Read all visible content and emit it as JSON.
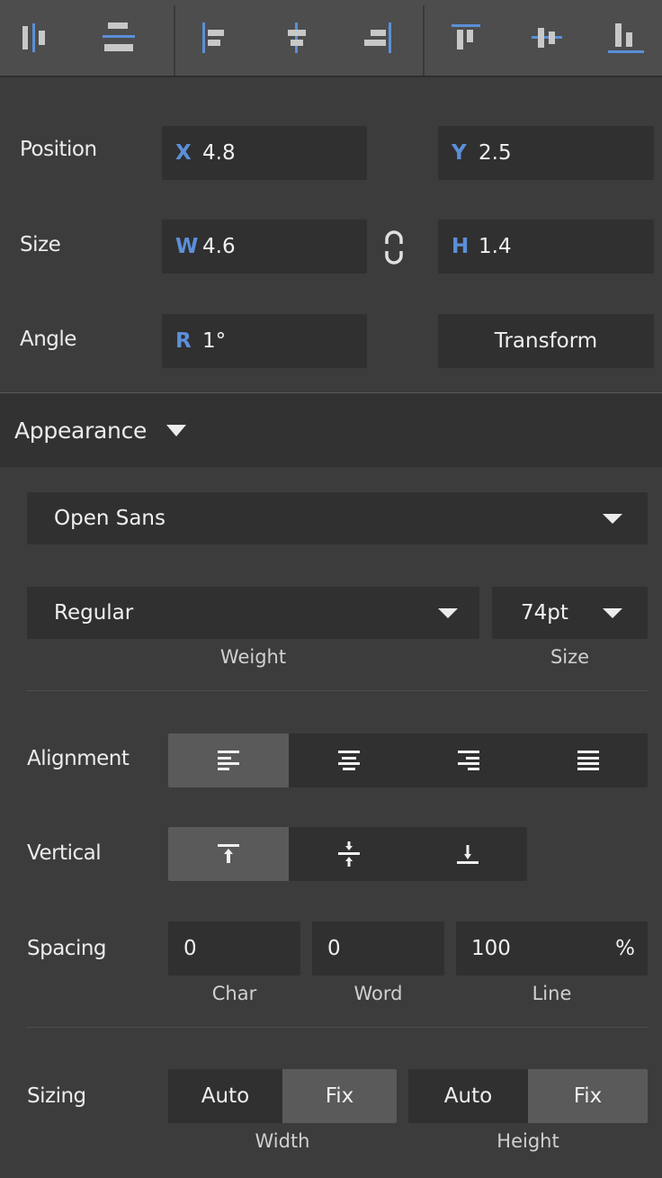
{
  "toolbar": {
    "distribute": [
      {
        "name": "distribute-horizontal-icon"
      },
      {
        "name": "distribute-vertical-icon"
      }
    ],
    "align_horizontal": [
      {
        "name": "align-left-icon"
      },
      {
        "name": "align-center-horizontal-icon"
      },
      {
        "name": "align-right-icon"
      }
    ],
    "align_vertical": [
      {
        "name": "align-top-icon"
      },
      {
        "name": "align-middle-vertical-icon"
      },
      {
        "name": "align-bottom-icon"
      }
    ],
    "accent_color": "#5b8fd9",
    "icon_color": "#c8c8c8"
  },
  "geometry": {
    "position": {
      "label": "Position",
      "x_axis": "X",
      "x": "4.8",
      "y_axis": "Y",
      "y": "2.5"
    },
    "size": {
      "label": "Size",
      "w_axis": "W",
      "w": "4.6",
      "h_axis": "H",
      "h": "1.4",
      "link_icon": "link-aspect-icon"
    },
    "angle": {
      "label": "Angle",
      "r_axis": "R",
      "r": "1°",
      "transform_label": "Transform"
    }
  },
  "appearance": {
    "title": "Appearance",
    "font_family": "Open Sans",
    "font_weight": "Regular",
    "font_size": "74pt",
    "weight_caption": "Weight",
    "size_caption": "Size",
    "alignment": {
      "label": "Alignment",
      "options": [
        "text-align-left-icon",
        "text-align-center-icon",
        "text-align-right-icon",
        "text-align-justify-icon"
      ],
      "selected": 0
    },
    "vertical": {
      "label": "Vertical",
      "options": [
        "vertical-align-top-icon",
        "vertical-align-middle-icon",
        "vertical-align-bottom-icon"
      ],
      "selected": 0
    },
    "spacing": {
      "label": "Spacing",
      "char": "0",
      "word": "0",
      "line": "100",
      "line_unit": "%",
      "char_caption": "Char",
      "word_caption": "Word",
      "line_caption": "Line"
    },
    "sizing": {
      "label": "Sizing",
      "width": {
        "auto": "Auto",
        "fix": "Fix",
        "selected": "fix",
        "caption": "Width"
      },
      "height": {
        "auto": "Auto",
        "fix": "Fix",
        "selected": "fix",
        "caption": "Height"
      }
    }
  }
}
